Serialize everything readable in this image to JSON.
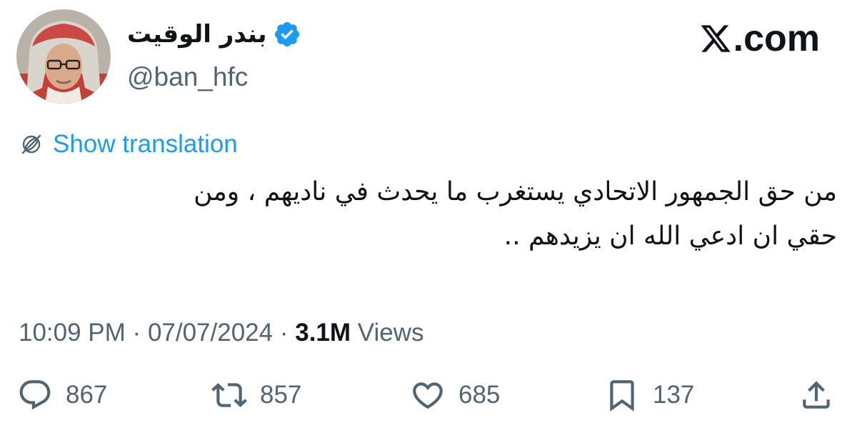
{
  "author": {
    "display_name": "بندر الوقيت",
    "handle": "@ban_hfc",
    "avatar": "avatar-photo",
    "verified": true
  },
  "brand": {
    "logo": "x-logo-icon",
    "suffix": ".com"
  },
  "translate": {
    "icon": "globe-icon",
    "label": "Show translation"
  },
  "tweet": {
    "lines": [
      "من حق الجمهور الاتحادي يستغرب ما يحدث في ناديهم ، ومن",
      "حقي ان ادعي الله ان يزيدهم .."
    ]
  },
  "meta": {
    "time": "10:09 PM",
    "separator": "·",
    "date": "07/07/2024",
    "views_count": "3.1M",
    "views_label": "Views"
  },
  "actions": {
    "replies": "867",
    "reposts": "857",
    "likes": "685",
    "bookmarks": "137"
  },
  "colors": {
    "accent": "#1d9bf0",
    "text": "#0f1419",
    "secondary": "#536471"
  }
}
